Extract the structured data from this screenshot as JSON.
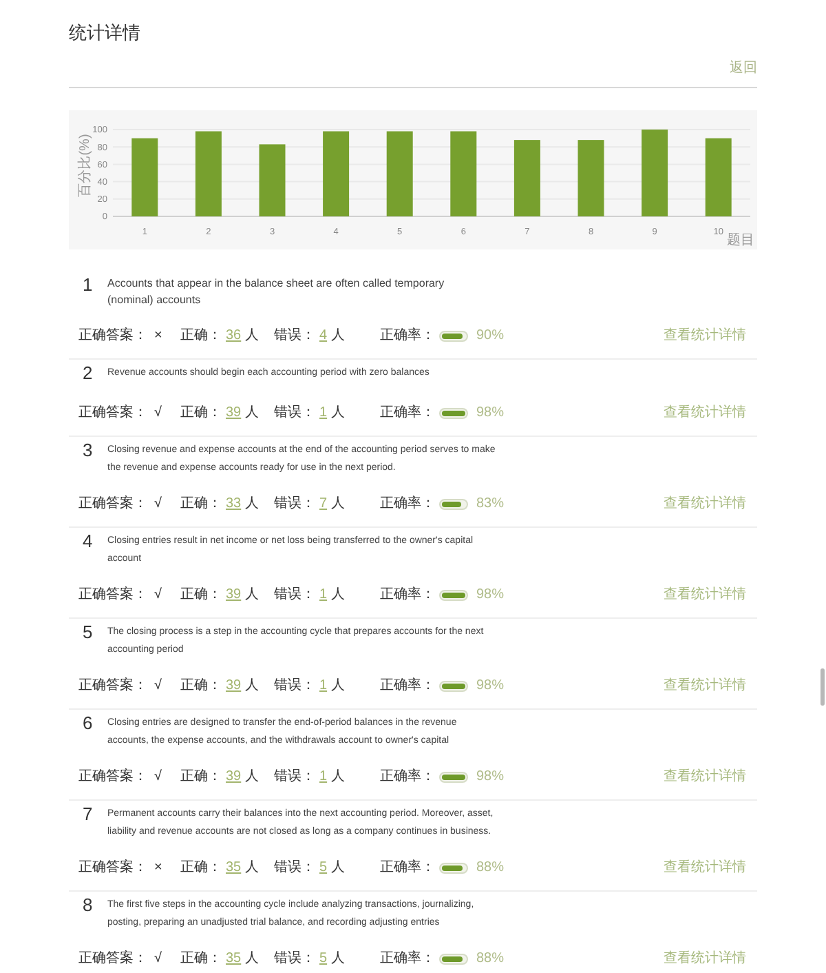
{
  "page": {
    "title": "统计详情",
    "back_link": "返回"
  },
  "chart": {
    "chart_data": {
      "type": "bar",
      "grid": true,
      "xlabel": "题目",
      "ylabel": "百分比(%)",
      "categories": [
        "1",
        "2",
        "3",
        "4",
        "5",
        "6",
        "7",
        "8",
        "9",
        "10"
      ],
      "values": [
        90,
        98,
        83,
        98,
        98,
        98,
        88,
        88,
        100,
        90
      ],
      "ylim": [
        0,
        100
      ],
      "yticks": [
        0,
        20,
        40,
        60,
        80,
        100
      ]
    }
  },
  "questions": [
    {
      "number": "1",
      "text": "Accounts that appear in the balance sheet are often called temporary (nominal) accounts",
      "answer_label": "正确答案：",
      "answer": "×",
      "correct_label": "正确：",
      "correct": "36",
      "correct_unit": "人",
      "wrong_label": "错误：",
      "wrong": "4",
      "wrong_unit": "人",
      "rate_label": "正确率：",
      "level": 0.9,
      "rate": "90%",
      "link": "查看统计详情"
    },
    {
      "number": "2",
      "text": "Revenue accounts should begin each accounting period with zero balances",
      "answer_label": "正确答案：",
      "answer": "√",
      "correct_label": "正确：",
      "correct": "39",
      "correct_unit": "人",
      "wrong_label": "错误：",
      "wrong": "1",
      "wrong_unit": "人",
      "rate_label": "正确率：",
      "level": 0.98,
      "rate": "98%",
      "link": "查看统计详情"
    },
    {
      "number": "3",
      "text": "Closing revenue and expense accounts at the end of the accounting period serves to make the revenue and expense accounts ready for use in the next period.",
      "answer_label": "正确答案：",
      "answer": "√",
      "correct_label": "正确：",
      "correct": "33",
      "correct_unit": "人",
      "wrong_label": "错误：",
      "wrong": "7",
      "wrong_unit": "人",
      "rate_label": "正确率：",
      "level": 0.83,
      "rate": "83%",
      "link": "查看统计详情"
    },
    {
      "number": "4",
      "text": "Closing entries result in net income or net loss being transferred to the owner's capital account",
      "answer_label": "正确答案：",
      "answer": "√",
      "correct_label": "正确：",
      "correct": "39",
      "correct_unit": "人",
      "wrong_label": "错误：",
      "wrong": "1",
      "wrong_unit": "人",
      "rate_label": "正确率：",
      "level": 0.98,
      "rate": "98%",
      "link": "查看统计详情"
    },
    {
      "number": "5",
      "text": "The closing process is a step in the accounting cycle that prepares accounts for the next accounting period",
      "answer_label": "正确答案：",
      "answer": "√",
      "correct_label": "正确：",
      "correct": "39",
      "correct_unit": "人",
      "wrong_label": "错误：",
      "wrong": "1",
      "wrong_unit": "人",
      "rate_label": "正确率：",
      "level": 0.98,
      "rate": "98%",
      "link": "查看统计详情"
    },
    {
      "number": "6",
      "text": "Closing entries are designed to transfer the end-of-period balances in the revenue accounts, the expense accounts, and the withdrawals account to owner's capital",
      "answer_label": "正确答案：",
      "answer": "√",
      "correct_label": "正确：",
      "correct": "39",
      "correct_unit": "人",
      "wrong_label": "错误：",
      "wrong": "1",
      "wrong_unit": "人",
      "rate_label": "正确率：",
      "level": 0.98,
      "rate": "98%",
      "link": "查看统计详情"
    },
    {
      "number": "7",
      "text": "Permanent accounts carry their balances into the next accounting period. Moreover, asset, liability and revenue accounts are not closed as long as a company continues in business.",
      "answer_label": "正确答案：",
      "answer": "×",
      "correct_label": "正确：",
      "correct": "35",
      "correct_unit": "人",
      "wrong_label": "错误：",
      "wrong": "5",
      "wrong_unit": "人",
      "rate_label": "正确率：",
      "level": 0.88,
      "rate": "88%",
      "link": "查看统计详情"
    },
    {
      "number": "8",
      "text": "The first five steps in the accounting cycle include analyzing transactions, journalizing, posting, preparing an unadjusted trial balance, and recording adjusting entries",
      "answer_label": "正确答案：",
      "answer": "√",
      "correct_label": "正确：",
      "correct": "35",
      "correct_unit": "人",
      "wrong_label": "错误：",
      "wrong": "5",
      "wrong_unit": "人",
      "rate_label": "正确率：",
      "level": 0.88,
      "rate": "88%",
      "link": "查看统计详情"
    }
  ]
}
